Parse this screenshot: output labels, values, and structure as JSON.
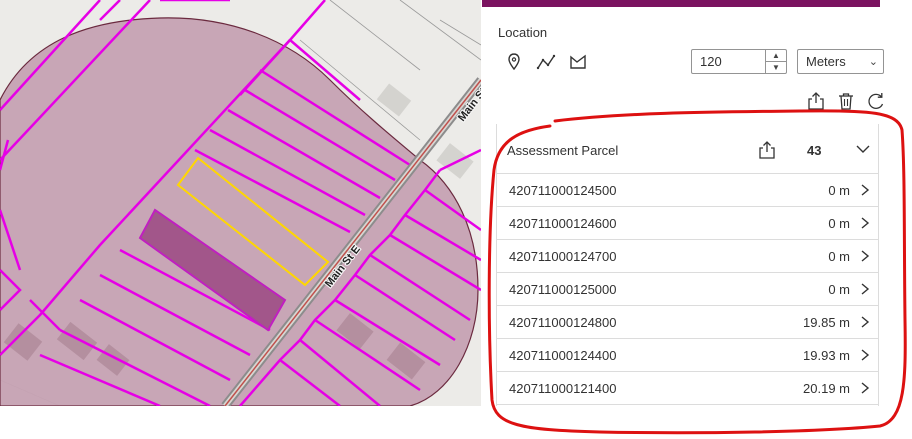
{
  "map": {
    "street_label_1": "Main St E",
    "street_label_2": "Main St"
  },
  "panel": {
    "accent_color": "#7b1360",
    "location_label": "Location",
    "tools": [
      {
        "name": "point-icon"
      },
      {
        "name": "polyline-icon"
      },
      {
        "name": "polygon-icon"
      }
    ],
    "distance_value": "120",
    "units": {
      "selected": "Meters"
    },
    "actions": [
      {
        "name": "export-icon"
      },
      {
        "name": "trash-icon"
      },
      {
        "name": "refresh-icon"
      }
    ]
  },
  "results": {
    "layer_title": "Assessment Parcel",
    "count": "43",
    "rows": [
      {
        "id": "420711000124500",
        "distance": "0 m"
      },
      {
        "id": "420711000124600",
        "distance": "0 m"
      },
      {
        "id": "420711000124700",
        "distance": "0 m"
      },
      {
        "id": "420711000125000",
        "distance": "0 m"
      },
      {
        "id": "420711000124800",
        "distance": "19.85 m"
      },
      {
        "id": "420711000124400",
        "distance": "19.93 m"
      },
      {
        "id": "420711000121400",
        "distance": "20.19 m"
      }
    ]
  },
  "colors": {
    "parcel_line": "#e600e6",
    "buffer_fill": "#c6a2b3",
    "selected_parcel": "#ffd700",
    "road_line": "#c0504d",
    "annotation": "#dd1111"
  }
}
